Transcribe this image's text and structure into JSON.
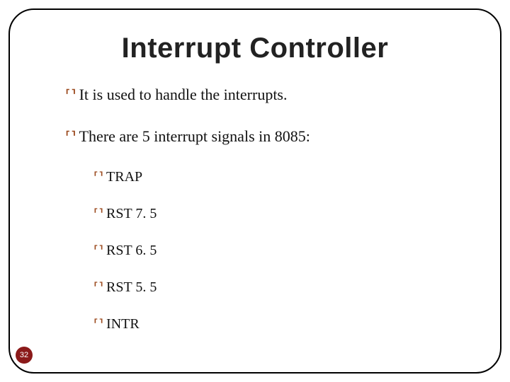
{
  "title": "Interrupt Controller",
  "bullets": {
    "b1": "It is used to handle the interrupts.",
    "b2": "There are 5 interrupt signals in 8085:"
  },
  "signals": {
    "s1": "TRAP",
    "s2": "RST 7. 5",
    "s3": "RST 6. 5",
    "s4": "RST 5. 5",
    "s5": "INTR"
  },
  "bullet_glyph": "་",
  "page_number": "32"
}
